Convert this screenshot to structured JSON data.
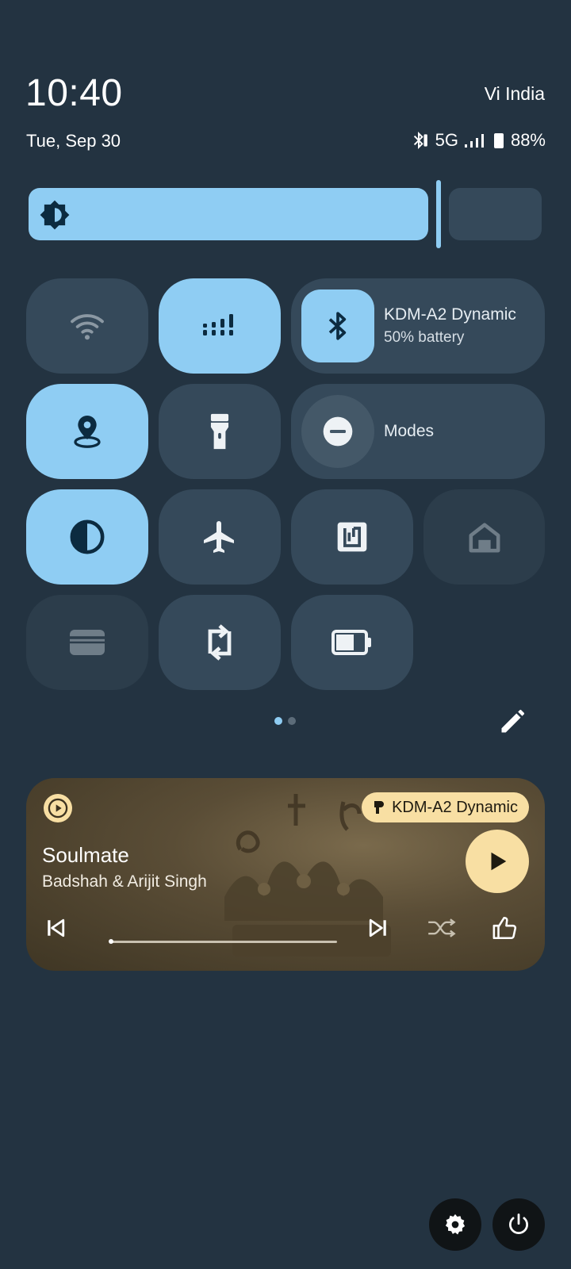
{
  "status": {
    "time": "10:40",
    "carrier": "Vi India",
    "date": "Tue, Sep 30",
    "network": "5G",
    "battery": "88%",
    "battery_level": 0.88
  },
  "brightness": {
    "icon": "brightness-icon",
    "level": 0.78
  },
  "tiles": [
    {
      "name": "wifi",
      "icon": "wifi-icon",
      "state": "inactive"
    },
    {
      "name": "mobile-data",
      "icon": "signal-icon",
      "state": "active"
    },
    {
      "name": "bluetooth",
      "icon": "bluetooth-icon",
      "state": "active",
      "title": "KDM-A2 Dynamic",
      "subtitle": "50% battery"
    },
    {
      "name": "location",
      "icon": "location-icon",
      "state": "active"
    },
    {
      "name": "flashlight",
      "icon": "flashlight-icon",
      "state": "inactive"
    },
    {
      "name": "modes",
      "icon": "do-not-disturb-icon",
      "state": "inactive",
      "title": "Modes"
    },
    {
      "name": "dark-theme",
      "icon": "contrast-icon",
      "state": "active"
    },
    {
      "name": "airplane-mode",
      "icon": "airplane-icon",
      "state": "inactive"
    },
    {
      "name": "nfc",
      "icon": "nfc-icon",
      "state": "inactive"
    },
    {
      "name": "home",
      "icon": "home-icon",
      "state": "unavailable"
    },
    {
      "name": "wallet",
      "icon": "wallet-icon",
      "state": "unavailable"
    },
    {
      "name": "auto-rotate",
      "icon": "rotate-icon",
      "state": "inactive"
    },
    {
      "name": "battery-saver",
      "icon": "battery-icon",
      "state": "inactive"
    }
  ],
  "pager": {
    "pages": 2,
    "current": 1
  },
  "media": {
    "app_icon": "play-circle-icon",
    "device": "KDM-A2 Dynamic",
    "title": "Soulmate",
    "artist": "Badshah & Arijit Singh",
    "progress": 0.0,
    "controls": [
      "skip-previous-icon",
      "skip-next-icon",
      "shuffle-icon",
      "thumbs-up-icon"
    ],
    "play_icon": "play-icon"
  },
  "footer": {
    "settings_icon": "settings-icon",
    "power_icon": "power-icon"
  },
  "colors": {
    "background": "#233341",
    "tile_inactive": "#35495a",
    "tile_active": "#8fcdf3",
    "tile_unavailable": "#2c3d4b",
    "media_accent": "#f8dfa3"
  }
}
